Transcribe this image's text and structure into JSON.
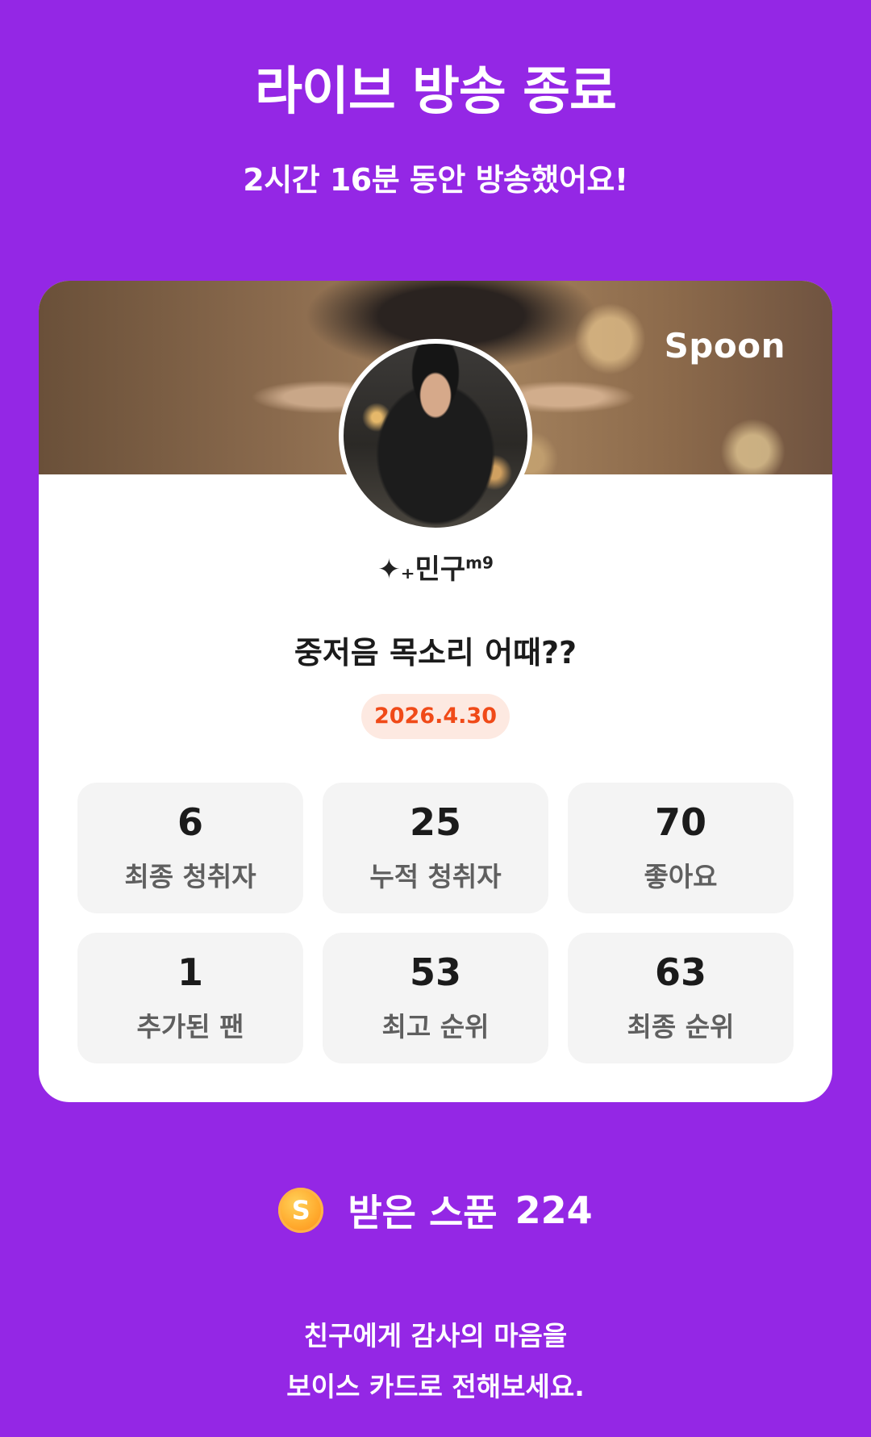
{
  "header": {
    "title": "라이브 방송 종료",
    "subtitle": "2시간 16분 동안 방송했어요!"
  },
  "card": {
    "brand": "Spoon",
    "nickname": "✦₊민구",
    "nickname_sup": "m9",
    "room_title": "중저음 목소리 어때??",
    "date": "2026.4.30",
    "stats": [
      {
        "value": "6",
        "label": "최종 청취자"
      },
      {
        "value": "25",
        "label": "누적 청취자"
      },
      {
        "value": "70",
        "label": "좋아요"
      },
      {
        "value": "1",
        "label": "추가된 팬"
      },
      {
        "value": "53",
        "label": "최고 순위"
      },
      {
        "value": "63",
        "label": "최종 순위"
      }
    ]
  },
  "spoons": {
    "coin_letter": "S",
    "label": "받은 스푼",
    "count": "224"
  },
  "footer": {
    "line1": "친구에게 감사의 마음을",
    "line2": "보이스 카드로 전해보세요."
  },
  "colors": {
    "background": "#9427e5",
    "date_text": "#f04a18",
    "date_bg": "#fde9e1",
    "coin": "#ffab2e"
  }
}
